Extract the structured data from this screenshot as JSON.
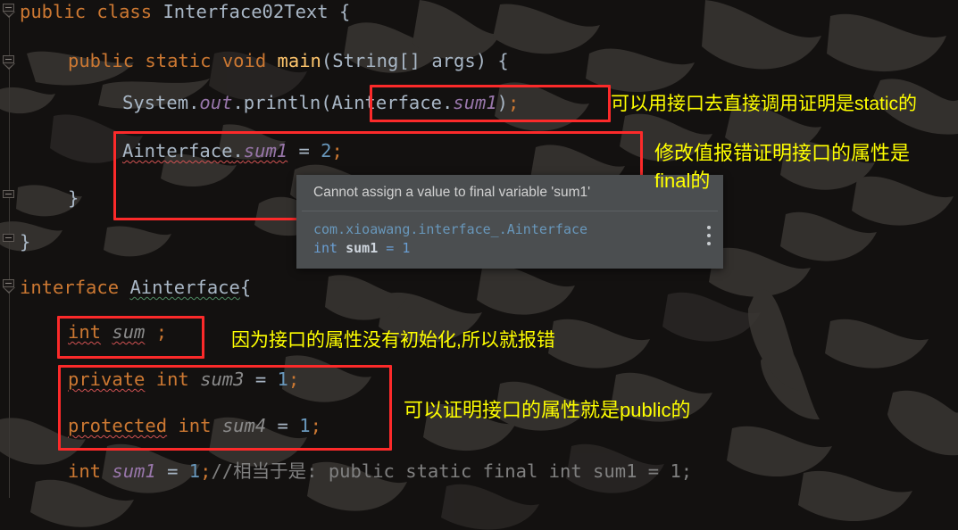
{
  "app": {
    "kind": "java-ide-code-editor",
    "theme": "darcula",
    "accent_error": "#fc2a2a",
    "accent_note": "#ffff00",
    "background": "#131110"
  },
  "code": {
    "lines": [
      {
        "id": "l1",
        "indent": 0,
        "tokens": [
          {
            "t": "public",
            "c": "kw"
          },
          {
            "t": " ",
            "c": "pun"
          },
          {
            "t": "class",
            "c": "kw"
          },
          {
            "t": " ",
            "c": "pun"
          },
          {
            "t": "Interface02Text",
            "c": "cls"
          },
          {
            "t": " ",
            "c": "pun"
          },
          {
            "t": "{",
            "c": "brc"
          }
        ],
        "text": "public class Interface02Text {"
      },
      {
        "id": "l2",
        "indent": 1,
        "tokens": [
          {
            "t": "public",
            "c": "kw"
          },
          {
            "t": " ",
            "c": "pun"
          },
          {
            "t": "static",
            "c": "kw"
          },
          {
            "t": " ",
            "c": "pun"
          },
          {
            "t": "void",
            "c": "kw"
          },
          {
            "t": " ",
            "c": "pun"
          },
          {
            "t": "main",
            "c": "mth"
          },
          {
            "t": "(",
            "c": "pun"
          },
          {
            "t": "String",
            "c": "cls"
          },
          {
            "t": "[] ",
            "c": "pun"
          },
          {
            "t": "args",
            "c": "pun"
          },
          {
            "t": ") ",
            "c": "pun"
          },
          {
            "t": "{",
            "c": "brc"
          }
        ],
        "text": "public static void main(String[] args) {"
      },
      {
        "id": "l3",
        "indent": 2,
        "tokens": [
          {
            "t": "System",
            "c": "cls"
          },
          {
            "t": ".",
            "c": "pun"
          },
          {
            "t": "out",
            "c": "fld"
          },
          {
            "t": ".",
            "c": "pun"
          },
          {
            "t": "println",
            "c": "pun"
          },
          {
            "t": "(",
            "c": "pun"
          },
          {
            "t": "Ainterface",
            "c": "cls"
          },
          {
            "t": ".",
            "c": "pun"
          },
          {
            "t": "sum1",
            "c": "fld"
          },
          {
            "t": ")",
            "c": "pun"
          },
          {
            "t": ";",
            "c": "semi"
          }
        ],
        "text": "System.out.println(Ainterface.sum1);"
      },
      {
        "id": "l4",
        "indent": 2,
        "tokens": [
          {
            "t": "Ainterface",
            "c": "cls err"
          },
          {
            "t": ".",
            "c": "pun err"
          },
          {
            "t": "sum1",
            "c": "fld err"
          },
          {
            "t": " = ",
            "c": "pun"
          },
          {
            "t": "2",
            "c": "num"
          },
          {
            "t": ";",
            "c": "semi"
          }
        ],
        "text": "Ainterface.sum1 = 2;"
      },
      {
        "id": "l5",
        "indent": 1,
        "tokens": [
          {
            "t": "}",
            "c": "brc"
          }
        ],
        "text": "}"
      },
      {
        "id": "l6",
        "indent": 0,
        "tokens": [
          {
            "t": "}",
            "c": "brc"
          }
        ],
        "text": "}"
      },
      {
        "id": "l7",
        "indent": 0,
        "tokens": [
          {
            "t": "interface",
            "c": "kw"
          },
          {
            "t": " ",
            "c": "pun"
          },
          {
            "t": "Ainterface",
            "c": "cls info"
          },
          {
            "t": "{",
            "c": "brc"
          }
        ],
        "text": "interface Ainterface{"
      },
      {
        "id": "l8",
        "indent": 1,
        "tokens": [
          {
            "t": "int",
            "c": "kw err"
          },
          {
            "t": " ",
            "c": "pun"
          },
          {
            "t": "sum",
            "c": "fld2 err"
          },
          {
            "t": " ",
            "c": "pun"
          },
          {
            "t": ";",
            "c": "semi"
          }
        ],
        "text": "int sum ;"
      },
      {
        "id": "l9",
        "indent": 1,
        "tokens": [
          {
            "t": "private",
            "c": "kw err"
          },
          {
            "t": " ",
            "c": "pun"
          },
          {
            "t": "int",
            "c": "kw"
          },
          {
            "t": " ",
            "c": "pun"
          },
          {
            "t": "sum3",
            "c": "fld2"
          },
          {
            "t": " = ",
            "c": "pun"
          },
          {
            "t": "1",
            "c": "num"
          },
          {
            "t": ";",
            "c": "semi"
          }
        ],
        "text": "private int sum3 = 1;"
      },
      {
        "id": "l10",
        "indent": 1,
        "tokens": [
          {
            "t": "protected",
            "c": "kw err"
          },
          {
            "t": " ",
            "c": "pun"
          },
          {
            "t": "int",
            "c": "kw"
          },
          {
            "t": " ",
            "c": "pun"
          },
          {
            "t": "sum4",
            "c": "fld2"
          },
          {
            "t": " = ",
            "c": "pun"
          },
          {
            "t": "1",
            "c": "num"
          },
          {
            "t": ";",
            "c": "semi"
          }
        ],
        "text": "protected int sum4 = 1;"
      },
      {
        "id": "l11",
        "indent": 1,
        "tokens": [
          {
            "t": "int",
            "c": "kw"
          },
          {
            "t": " ",
            "c": "pun"
          },
          {
            "t": "sum1",
            "c": "fld"
          },
          {
            "t": " = ",
            "c": "pun"
          },
          {
            "t": "1",
            "c": "num"
          },
          {
            "t": ";",
            "c": "semi"
          },
          {
            "t": "//相当于是: public static final int sum1 = 1;",
            "c": "cmt"
          }
        ],
        "text": "int sum1 = 1;//相当于是: public static final int sum1 = 1;"
      }
    ]
  },
  "tooltip": {
    "message": "Cannot assign a value to final variable 'sum1'",
    "fqn": "com.xioawang.interface_.Ainterface",
    "declaration_kw": "int",
    "declaration_name": "sum1",
    "declaration_rest": "= 1",
    "kebab_icon": "more-vertical-icon"
  },
  "annotations": [
    {
      "id": "note1",
      "text": "可以用接口去直接调用证明是static的",
      "target": "println-call"
    },
    {
      "id": "note2",
      "line1": "修改值报错证明接口的属性是",
      "line2": "final的",
      "target": "assign-final"
    },
    {
      "id": "note3",
      "text": "因为接口的属性没有初始化,所以就报错",
      "target": "uninitialized-field"
    },
    {
      "id": "note4",
      "text": "可以证明接口的属性就是public的",
      "target": "access-modifiers"
    }
  ],
  "highlight_boxes": [
    {
      "id": "box-println-arg",
      "label": "Ainterface.sum1 call"
    },
    {
      "id": "box-assign",
      "label": "Ainterface.sum1 = 2;"
    },
    {
      "id": "box-int-sum",
      "label": "int sum ;"
    },
    {
      "id": "box-modifiers",
      "label": "private/protected fields"
    }
  ],
  "gutter": {
    "fold_markers": [
      {
        "id": "fold-class",
        "state": "expanded"
      },
      {
        "id": "fold-main",
        "state": "expanded"
      },
      {
        "id": "fold-brace-1",
        "state": "expanded"
      },
      {
        "id": "fold-brace-2",
        "state": "expanded"
      },
      {
        "id": "fold-interface",
        "state": "expanded"
      }
    ]
  }
}
